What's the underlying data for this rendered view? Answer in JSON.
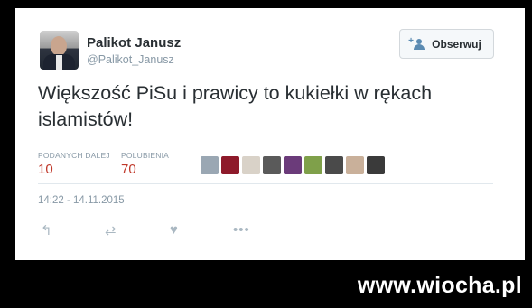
{
  "author": {
    "name": "Palikot Janusz",
    "handle": "@Palikot_Janusz",
    "avatar_icon": "profile-photo"
  },
  "follow_button": {
    "label": "Obserwuj",
    "icon": "add-user-icon"
  },
  "tweet": {
    "text": "Większość PiSu i prawicy to kukiełki w rękach islamistów!"
  },
  "stats": [
    {
      "label": "PODANYCH DALEJ",
      "value": "10"
    },
    {
      "label": "POLUBIENIA",
      "value": "70"
    }
  ],
  "likers_colors": [
    "#9aa7b3",
    "#8e1a2b",
    "#d9d2c8",
    "#5a5a5a",
    "#6b3b7a",
    "#7fa04a",
    "#4a4a4a",
    "#c9b09a",
    "#3a3a3a"
  ],
  "timestamp": "14:22 - 14.11.2015",
  "actions": [
    {
      "name": "reply-icon",
      "glyph": "↰"
    },
    {
      "name": "retweet-icon",
      "glyph": "⇄"
    },
    {
      "name": "heart-icon",
      "glyph": "♥"
    },
    {
      "name": "more-icon",
      "glyph": "•••"
    }
  ],
  "watermark": "www.wiocha.pl",
  "colors": {
    "accent_stat": "#c0392b",
    "muted": "#8899a6",
    "text": "#292f33"
  }
}
